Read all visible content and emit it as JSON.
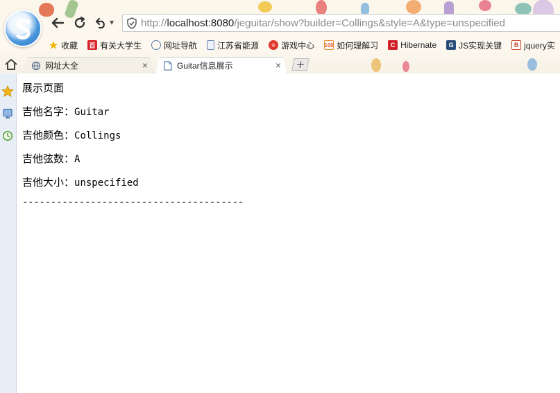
{
  "browser": {
    "address": {
      "scheme": "http://",
      "host": "localhost:8080",
      "path": "/jeguitar/show?builder=Collings&style=A&type=unspecified"
    },
    "bookmarks": [
      {
        "label": "收藏",
        "icon": "star-icon"
      },
      {
        "label": "有关大学生",
        "icon": "baidu-icon"
      },
      {
        "label": "网址导航",
        "icon": "globe-icon"
      },
      {
        "label": "江苏省能源",
        "icon": "page-icon"
      },
      {
        "label": "游戏中心",
        "icon": "game-icon"
      },
      {
        "label": "如何理解习",
        "icon": "site-icon"
      },
      {
        "label": "Hibernate",
        "icon": "c-icon"
      },
      {
        "label": "JS实现关键",
        "icon": "g-icon"
      },
      {
        "label": "jquery实",
        "icon": "b-icon"
      }
    ],
    "tabs": [
      {
        "label": "网址大全",
        "icon": "globe-icon",
        "active": false
      },
      {
        "label": "Guitar信息展示",
        "icon": "page-icon",
        "active": true
      }
    ],
    "new_tab_label": "+",
    "close_glyph": "×"
  },
  "page": {
    "heading": "展示页面",
    "fields": [
      {
        "label": "吉他名字：",
        "value": "Guitar"
      },
      {
        "label": "吉他颜色：",
        "value": "Collings"
      },
      {
        "label": "吉他弦数：",
        "value": "A"
      },
      {
        "label": "吉他大小：",
        "value": "unspecified"
      }
    ],
    "divider": "---------------------------------------"
  }
}
